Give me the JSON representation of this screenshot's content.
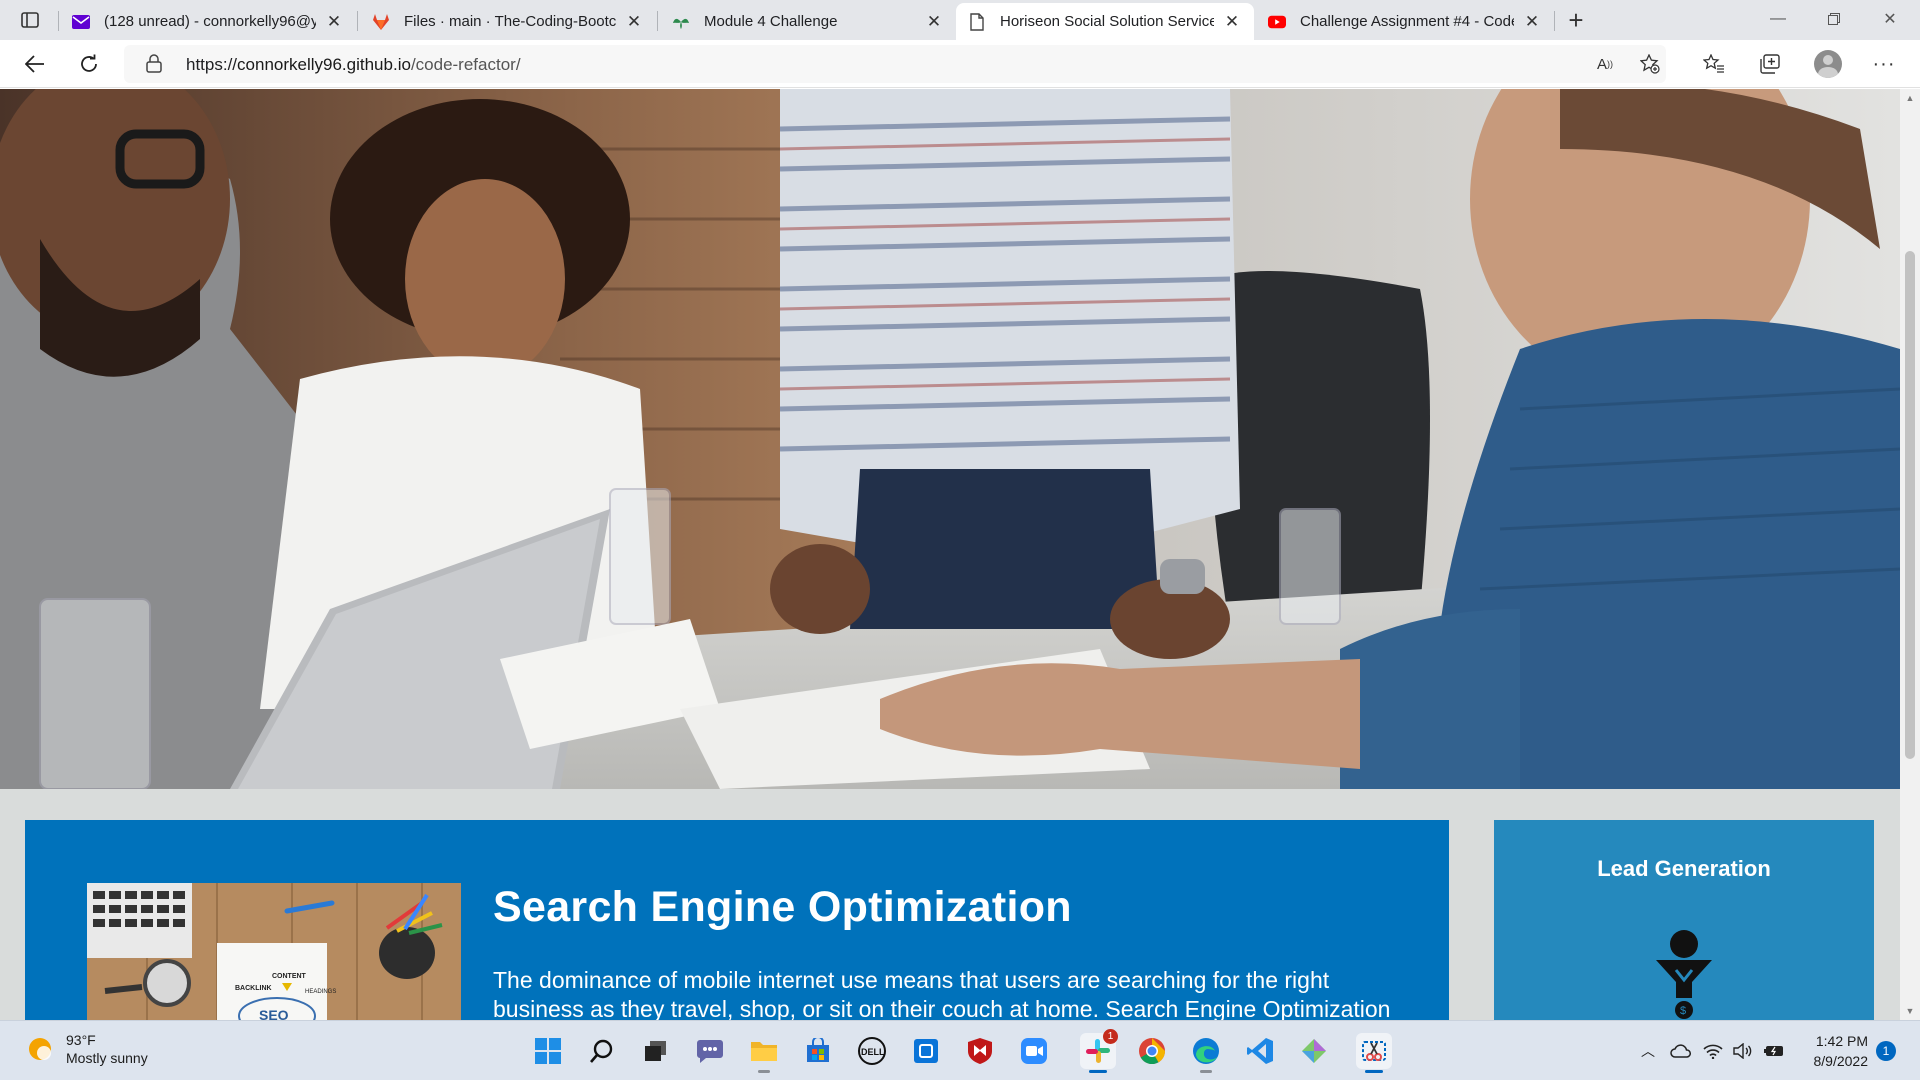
{
  "browser": {
    "tabs": [
      {
        "title": "(128 unread) - connorkelly96@y",
        "icon": "yahoo-mail-icon",
        "active": false
      },
      {
        "title": "Files · main · The-Coding-Bootca",
        "icon": "gitlab-icon",
        "active": false
      },
      {
        "title": "Module 4 Challenge",
        "icon": "canvas-icon",
        "active": false
      },
      {
        "title": "Horiseon Social Solution Service",
        "icon": "page-icon",
        "active": true
      },
      {
        "title": "Challenge Assignment #4 - Code",
        "icon": "youtube-icon",
        "active": false
      }
    ],
    "address": {
      "scheme": "https://",
      "host": "connorkelly96.github.io",
      "path": "/code-refactor/"
    }
  },
  "page": {
    "seo": {
      "title": "Search Engine Optimization",
      "text": "The dominance of mobile internet use means that users are searching for the right business as they travel, shop, or sit on their couch at home. Search Engine Optimization"
    },
    "seo_image_labels": {
      "content": "CONTENT",
      "backlink": "BACKLINK",
      "headings": "HEADINGS",
      "seo": "SEO"
    },
    "lead": {
      "title": "Lead Generation"
    }
  },
  "taskbar": {
    "weather": {
      "temp": "93°F",
      "condition": "Mostly sunny"
    },
    "apps": [
      "windows-start",
      "search",
      "task-view",
      "teams-chat",
      "file-explorer",
      "microsoft-store",
      "dell",
      "app-square",
      "mcafee",
      "zoom",
      "slack",
      "chrome",
      "edge",
      "vscode",
      "gitkraken",
      "snipping-tool"
    ],
    "slack_badge": "1",
    "clock": {
      "time": "1:42 PM",
      "date": "8/9/2022"
    },
    "notification_count": "1"
  },
  "colors": {
    "seo_card": "#0072bb",
    "lead_card": "#2589bd",
    "page_bg": "#d9dcdb"
  }
}
